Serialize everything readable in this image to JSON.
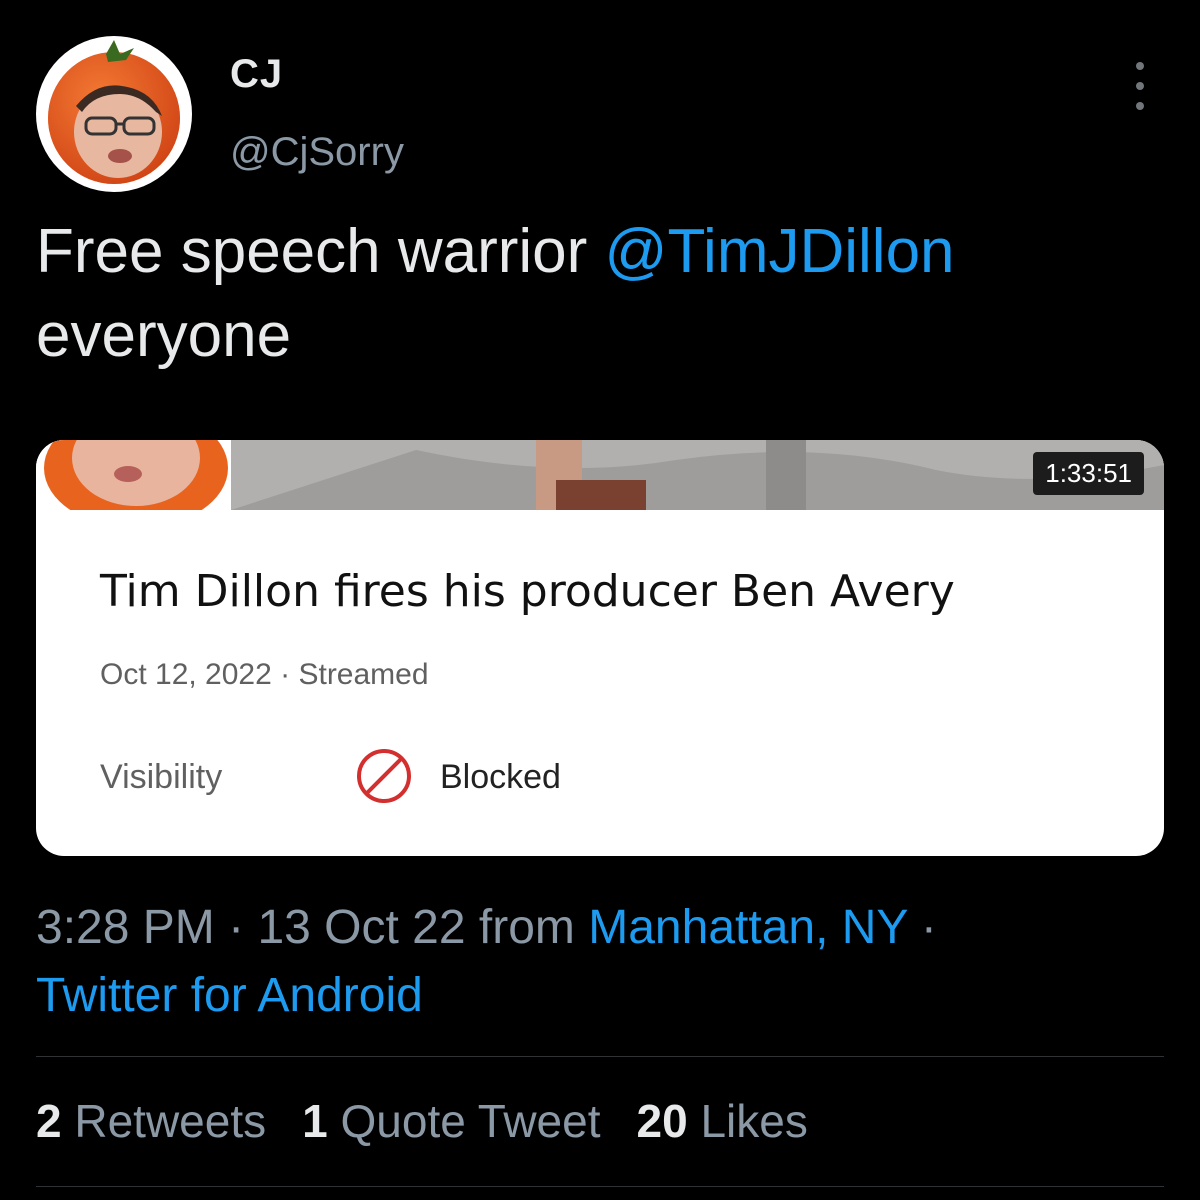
{
  "author": {
    "display_name": "CJ",
    "handle": "@CjSorry",
    "avatar_icon": "tomato-face-avatar"
  },
  "tweet": {
    "text_before": "Free speech warrior ",
    "mention": "@TimJDillon",
    "text_after": "everyone"
  },
  "card": {
    "duration": "1:33:51",
    "title": "Tim Dillon fires his producer Ben Avery",
    "date": "Oct 12, 2022",
    "separator": " · ",
    "status": "Streamed",
    "visibility_label": "Visibility",
    "visibility_value": "Blocked",
    "visibility_icon": "blocked-icon"
  },
  "meta": {
    "time": "3:28 PM",
    "date": "13 Oct 22",
    "from_label": "from",
    "location": "Manhattan, NY",
    "source": "Twitter for Android",
    "dot": "·"
  },
  "stats": {
    "retweets_count": "2",
    "retweets_label": "Retweets",
    "quotes_count": "1",
    "quotes_label": "Quote Tweet",
    "likes_count": "20",
    "likes_label": "Likes"
  },
  "colors": {
    "background": "#000000",
    "text": "#e7e9ea",
    "muted": "#8b98a5",
    "accent": "#1d9bf0",
    "blocked": "#d32f2f"
  }
}
